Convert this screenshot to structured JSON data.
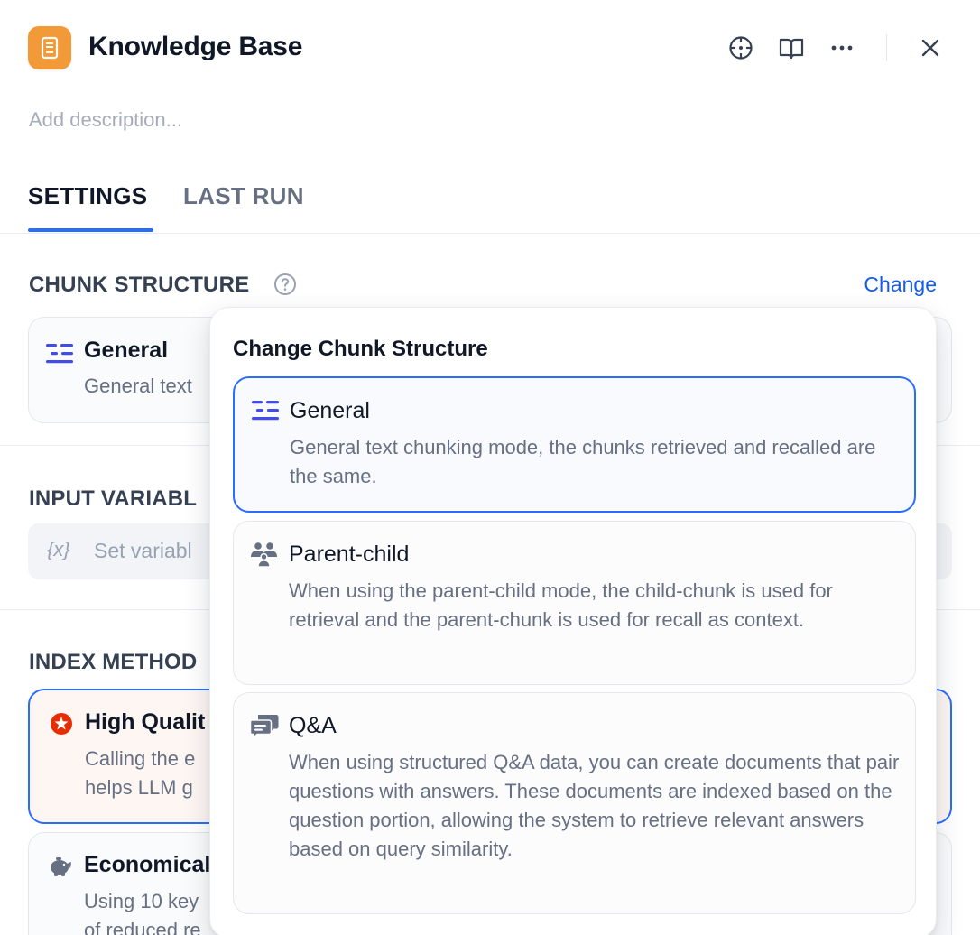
{
  "header": {
    "title": "Knowledge Base",
    "description_placeholder": "Add description...",
    "icons": [
      "book-icon",
      "crosshair-icon",
      "open-book-icon",
      "more-icon",
      "close-icon"
    ]
  },
  "tabs": [
    {
      "label": "SETTINGS",
      "active": true
    },
    {
      "label": "LAST RUN",
      "active": false
    }
  ],
  "chunk_structure": {
    "label": "CHUNK STRUCTURE",
    "change_label": "Change",
    "current": {
      "title": "General",
      "text": "General text"
    }
  },
  "input_variables": {
    "label": "INPUT VARIABL",
    "icon": "{x}",
    "placeholder": "Set variabl"
  },
  "index_method": {
    "label": "INDEX METHOD",
    "options": [
      {
        "title": "High Qualit",
        "line1": "Calling the e",
        "line2": "helps LLM g"
      },
      {
        "title": "Economical",
        "line1": "Using 10 key",
        "line2": "of reduced re"
      }
    ]
  },
  "popover": {
    "title": "Change Chunk Structure",
    "options": [
      {
        "title": "General",
        "text": "General text chunking mode, the chunks retrieved and recalled are the same.",
        "selected": true
      },
      {
        "title": "Parent-child",
        "text": "When using the parent-child mode, the child-chunk is used for retrieval and the parent-chunk is used for recall as context.",
        "selected": false
      },
      {
        "title": "Q&A",
        "text": "When using structured Q&A data, you can create documents that pair questions with answers. These documents are indexed based on the question portion, allowing the system to retrieve relevant answers based on query similarity.",
        "selected": false
      }
    ]
  },
  "colors": {
    "accent": "#296dff",
    "link": "#155aef",
    "app_icon": "#f29a38",
    "general_icon": "#444ce7",
    "high_quality_icon": "#e62e05"
  }
}
